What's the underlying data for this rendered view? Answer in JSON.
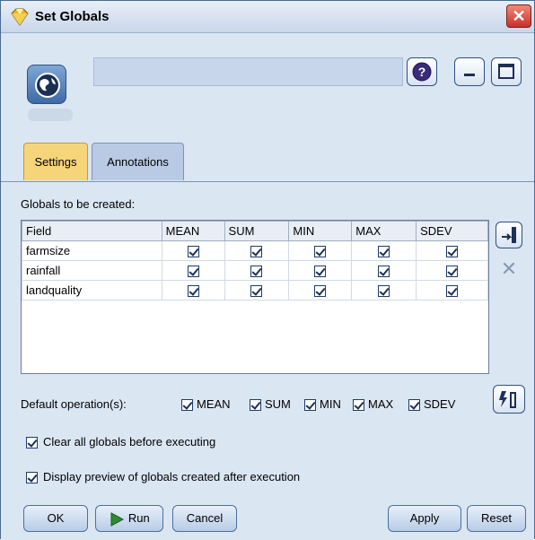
{
  "window": {
    "title": "Set Globals"
  },
  "tabs": [
    {
      "label": "Settings"
    },
    {
      "label": "Annotations"
    }
  ],
  "settings": {
    "globals_label": "Globals to be created:",
    "columns": [
      "Field",
      "MEAN",
      "SUM",
      "MIN",
      "MAX",
      "SDEV"
    ],
    "rows": [
      {
        "field": "farmsize",
        "mean": true,
        "sum": true,
        "min": true,
        "max": true,
        "sdev": true
      },
      {
        "field": "rainfall",
        "mean": true,
        "sum": true,
        "min": true,
        "max": true,
        "sdev": true
      },
      {
        "field": "landquality",
        "mean": true,
        "sum": true,
        "min": true,
        "max": true,
        "sdev": true
      }
    ],
    "default_ops_label": "Default operation(s):",
    "default_ops": [
      {
        "label": "MEAN",
        "checked": true
      },
      {
        "label": "SUM",
        "checked": true
      },
      {
        "label": "MIN",
        "checked": true
      },
      {
        "label": "MAX",
        "checked": true
      },
      {
        "label": "SDEV",
        "checked": true
      }
    ],
    "clear_all_label": "Clear all globals before executing",
    "display_preview_label": "Display preview of globals created after execution"
  },
  "buttons": {
    "ok": "OK",
    "run": "Run",
    "cancel": "Cancel",
    "apply": "Apply",
    "reset": "Reset"
  }
}
